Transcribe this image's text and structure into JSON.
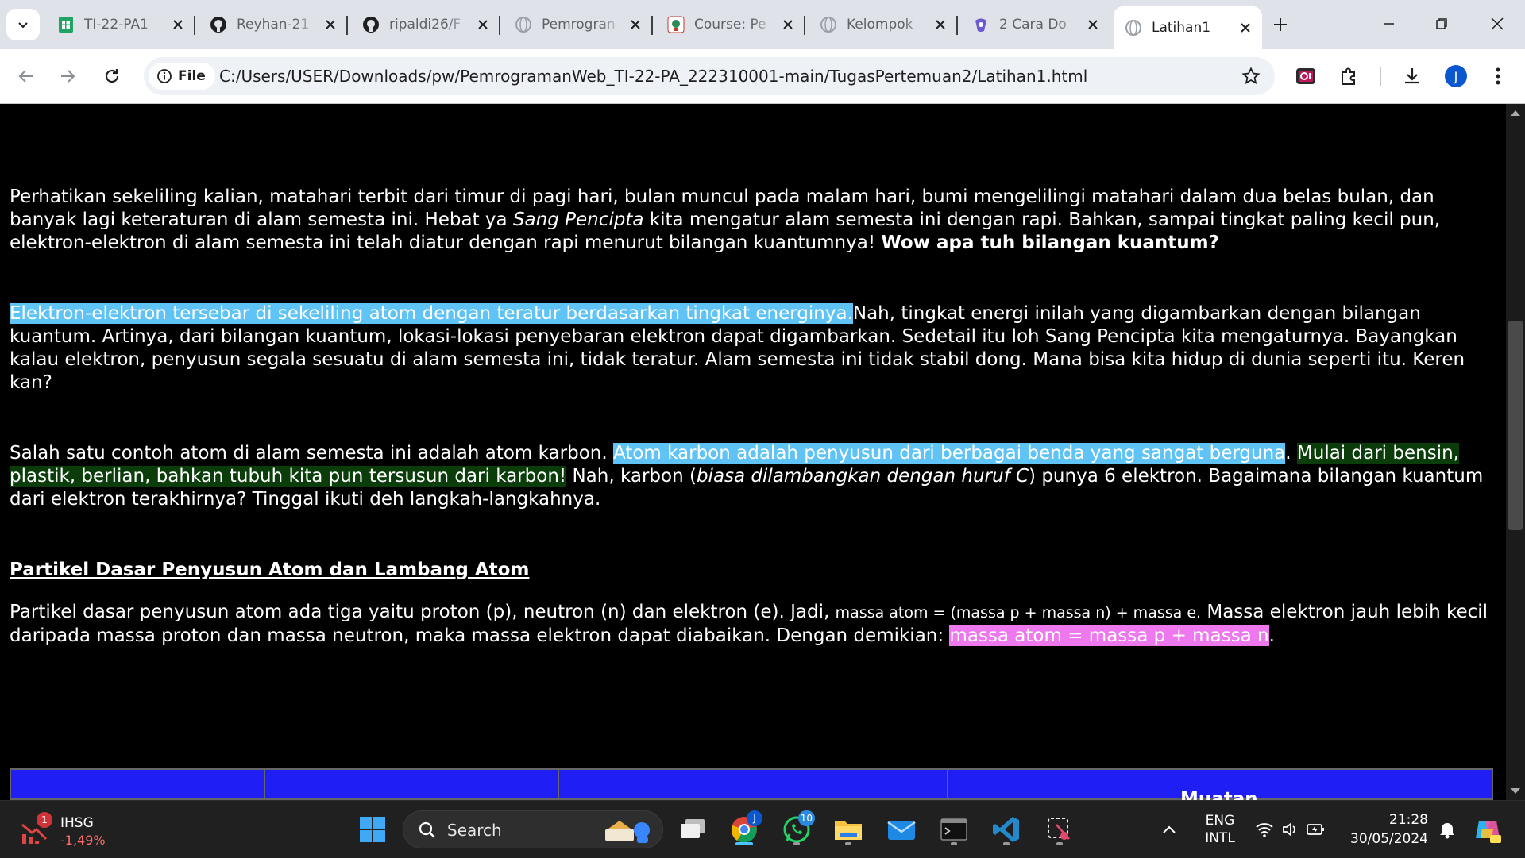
{
  "browser": {
    "tabs": [
      {
        "title": "TI-22-PA1",
        "icon": "sheets-icon"
      },
      {
        "title": "Reyhan-21",
        "icon": "github-icon"
      },
      {
        "title": "ripaldi26/F",
        "icon": "github-icon"
      },
      {
        "title": "Pemrogran",
        "icon": "globe-icon"
      },
      {
        "title": "Course: Pe",
        "icon": "course-icon"
      },
      {
        "title": "Kelompok",
        "icon": "globe-icon"
      },
      {
        "title": "2 Cara Do",
        "icon": "cara-icon"
      },
      {
        "title": "Latihan1",
        "icon": "globe-icon",
        "active": true
      }
    ],
    "chip_label": "File",
    "url": "C:/Users/USER/Downloads/pw/PemrogramanWeb_TI-22-PA_222310001-main/TugasPertemuan2/Latihan1.html",
    "profile_initial": "J"
  },
  "page": {
    "p1": {
      "a": "Perhatikan sekeliling kalian, matahari terbit dari timur di pagi hari, bulan muncul pada malam hari, bumi mengelilingi matahari dalam dua belas bulan, dan banyak lagi keteraturan di alam semesta ini. Hebat ya ",
      "em": "Sang Pencipta",
      "b": " kita mengatur alam semesta ini dengan rapi. Bahkan, sampai tingkat paling kecil pun, elektron-elektron di alam semesta ini telah diatur dengan rapi menurut bilangan kuantumnya! ",
      "strong": "Wow apa tuh bilangan kuantum?"
    },
    "p2": {
      "highlight": "Elektron-elektron tersebar di sekeliling atom dengan teratur berdasarkan tingkat energinya.",
      "rest": "Nah, tingkat energi inilah yang digambarkan dengan bilangan kuantum. Artinya, dari bilangan kuantum, lokasi-lokasi penyebaran elektron dapat digambarkan. Sedetail itu loh Sang Pencipta kita mengaturnya. Bayangkan kalau elektron, penyusun segala sesuatu di alam semesta ini, tidak teratur. Alam semesta ini tidak stabil dong. Mana bisa kita hidup di dunia seperti itu. Keren kan?"
    },
    "p3": {
      "a": "Salah satu contoh atom di alam semesta ini adalah atom karbon. ",
      "highlight": "Atom karbon adalah penyusun dari berbagai benda yang sangat berguna",
      "b": ". ",
      "green": "Mulai dari bensin, plastik, berlian, bahkan tubuh kita pun tersusun dari karbon!",
      "c": " Nah, karbon (",
      "em": "biasa dilambangkan dengan huruf C",
      "d": ") punya 6 elektron. Bagaimana bilangan kuantum dari elektron terakhirnya? Tinggal ikuti deh langkah-langkahnya."
    },
    "heading": "Partikel Dasar Penyusun Atom dan Lambang Atom",
    "p4": {
      "a": "Partikel dasar penyusun atom ada tiga yaitu proton (p), neutron (n) dan elektron (e). Jadi, ",
      "small": "massa atom = (massa p + massa n) + massa e.",
      "b": " Massa elektron jauh lebih kecil daripada massa proton dan massa neutron, maka massa elektron dapat diabaikan. Dengan demikian: ",
      "highlight": "massa atom = massa p + massa n",
      "c": "."
    },
    "table_header_partial": "Muatan"
  },
  "taskbar": {
    "widget": {
      "name": "IHSG",
      "change": "-1,49%",
      "badge": "1"
    },
    "search_label": "Search",
    "whatsapp_badge": "10",
    "chrome_badge": "J",
    "lang_top": "ENG",
    "lang_bottom": "INTL",
    "time": "21:28",
    "date": "30/05/2024"
  },
  "colors": {
    "highlight_blue": "#5fc3f5",
    "highlight_green": "#0b3d0b",
    "highlight_pink": "#ee78ee",
    "table_blue": "#1f1ff5"
  }
}
